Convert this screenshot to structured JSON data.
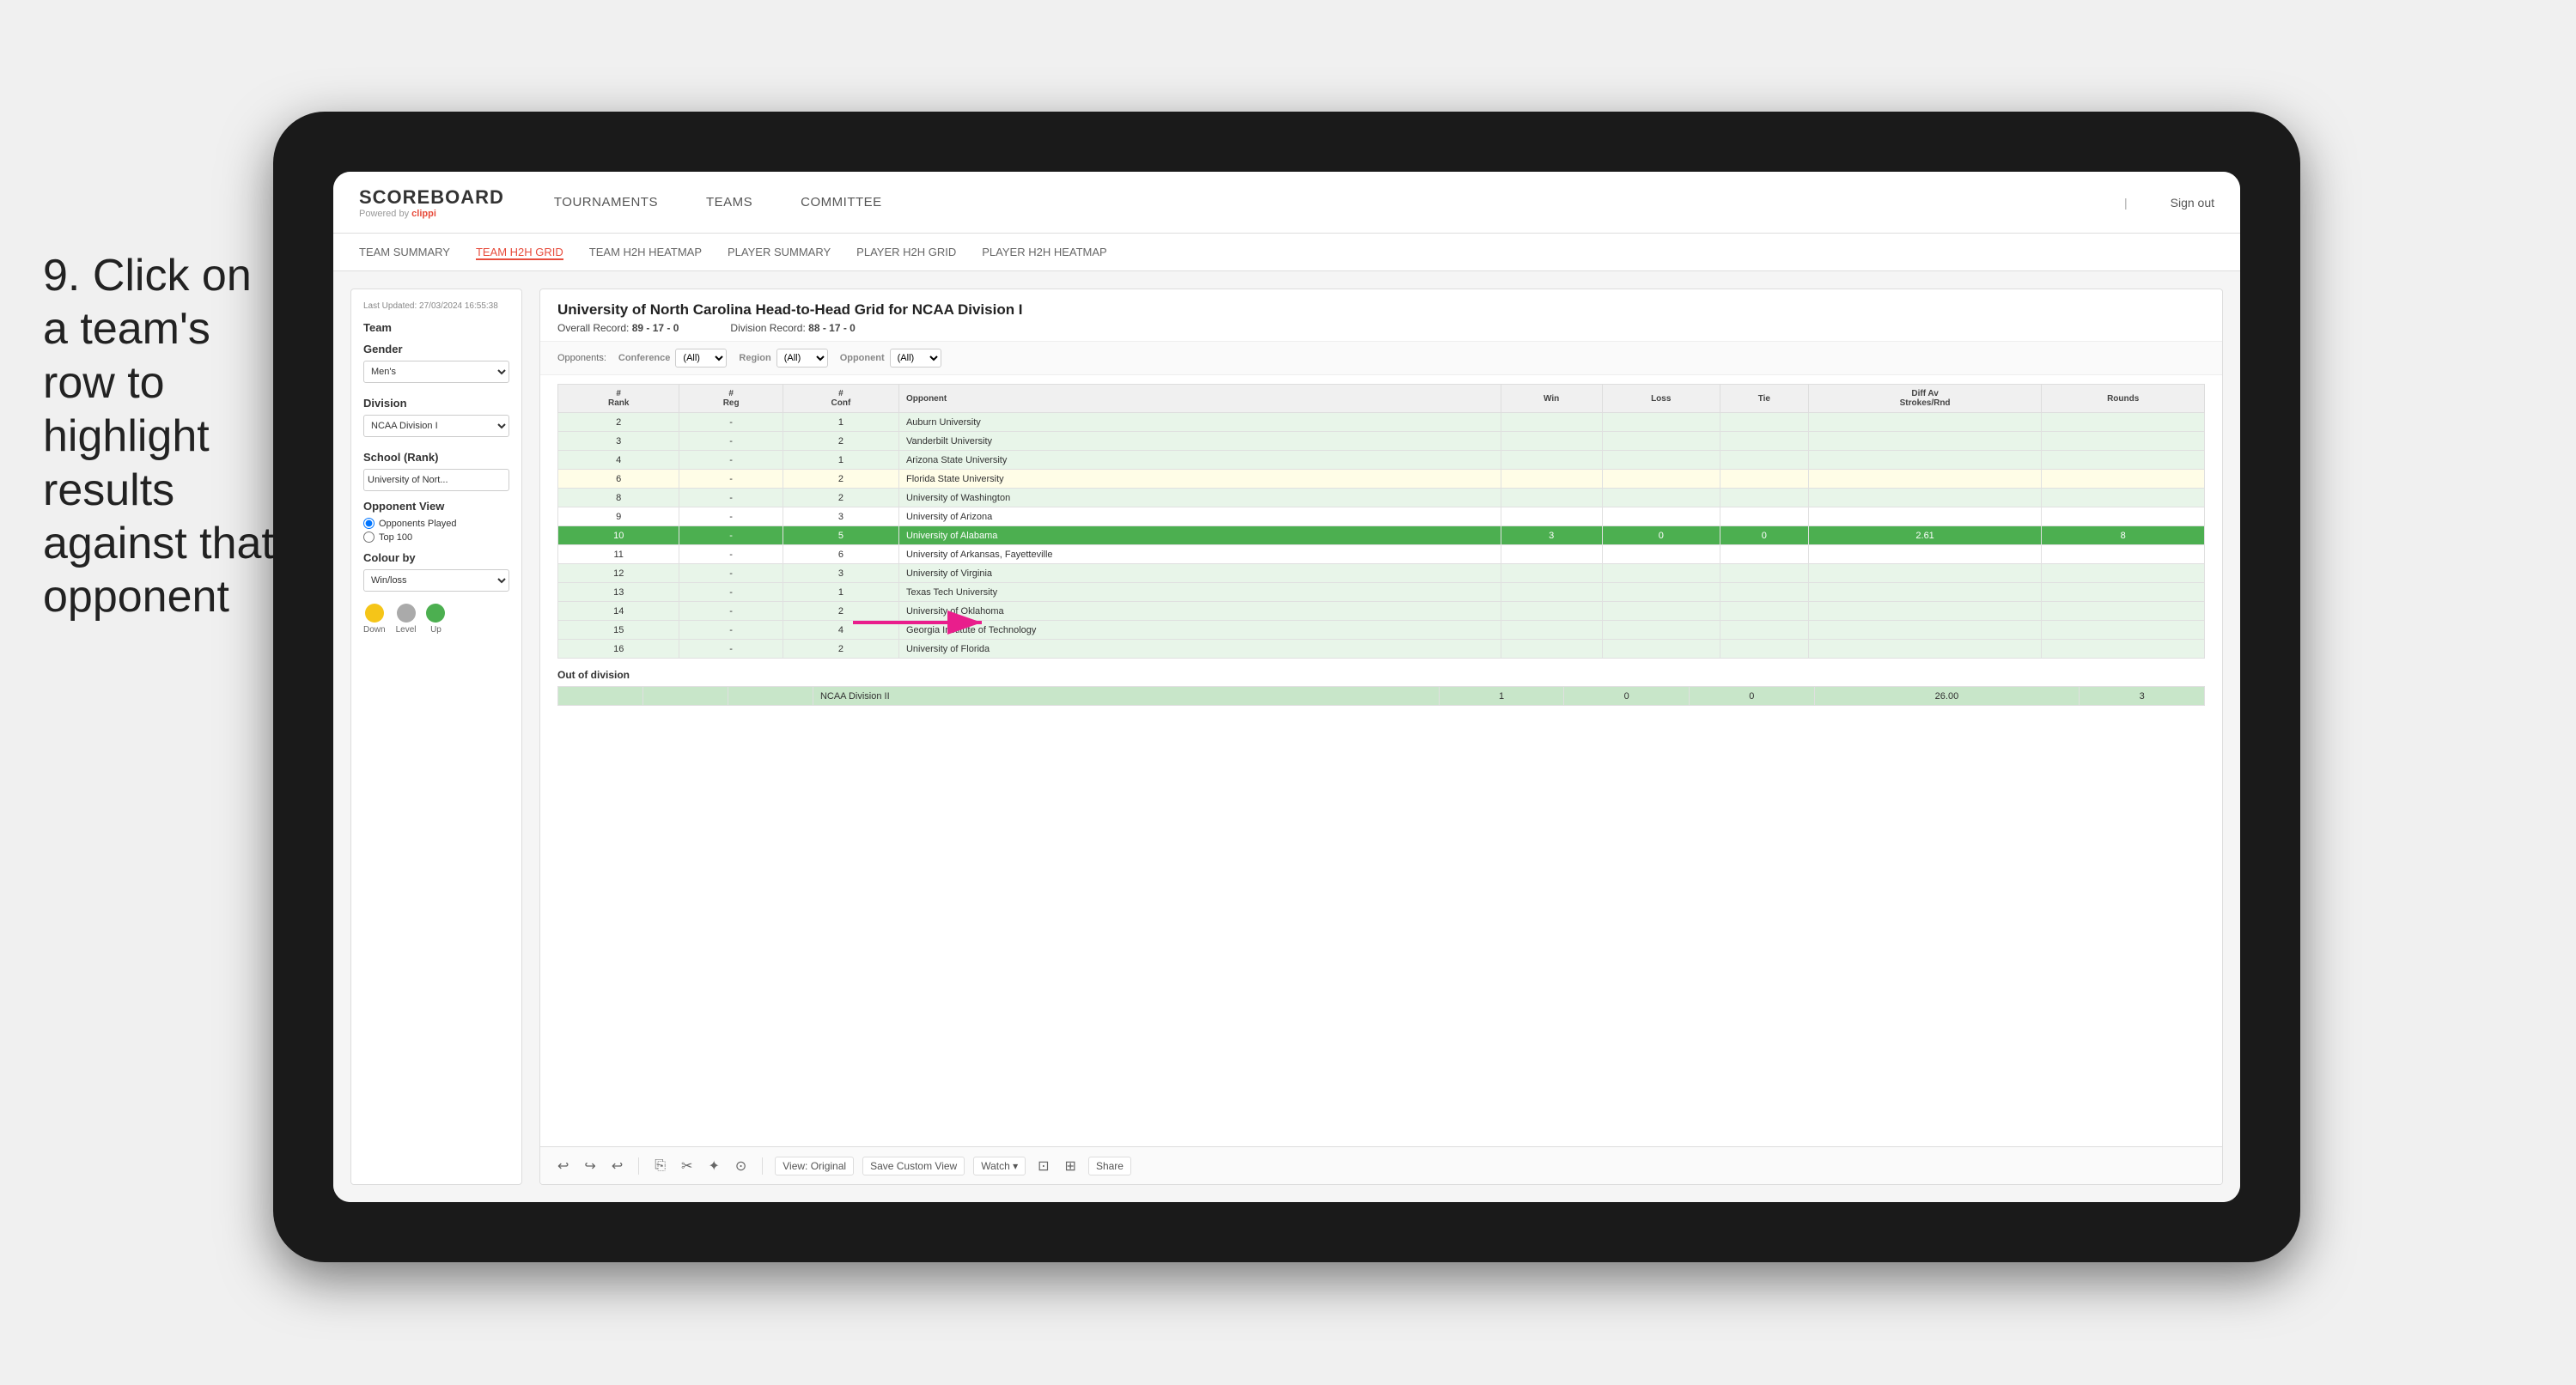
{
  "instruction": {
    "text": "9. Click on a team's row to highlight results against that opponent"
  },
  "header": {
    "logo": "SCOREBOARD",
    "powered_by": "Powered by clippi",
    "nav": {
      "tournaments": "TOURNAMENTS",
      "teams": "TEAMS",
      "committee": "COMMITTEE",
      "sign_out": "Sign out"
    }
  },
  "sub_nav": {
    "items": [
      {
        "label": "TEAM SUMMARY",
        "active": false
      },
      {
        "label": "TEAM H2H GRID",
        "active": true
      },
      {
        "label": "TEAM H2H HEATMAP",
        "active": false
      },
      {
        "label": "PLAYER SUMMARY",
        "active": false
      },
      {
        "label": "PLAYER H2H GRID",
        "active": false
      },
      {
        "label": "PLAYER H2H HEATMAP",
        "active": false
      }
    ]
  },
  "sidebar": {
    "last_updated": "Last Updated: 27/03/2024 16:55:38",
    "team_label": "Team",
    "gender_label": "Gender",
    "gender_value": "Men's",
    "division_label": "Division",
    "division_value": "NCAA Division I",
    "school_label": "School (Rank)",
    "school_value": "University of Nort...",
    "opponent_view_label": "Opponent View",
    "radio_options": [
      {
        "label": "Opponents Played",
        "selected": true
      },
      {
        "label": "Top 100",
        "selected": false
      }
    ],
    "colour_by_label": "Colour by",
    "colour_by_value": "Win/loss",
    "swatches": [
      {
        "color": "#f5c518",
        "label": "Down"
      },
      {
        "color": "#aaa",
        "label": "Level"
      },
      {
        "color": "#4caf50",
        "label": "Up"
      }
    ]
  },
  "main": {
    "title": "University of North Carolina Head-to-Head Grid for NCAA Division I",
    "overall_record_label": "Overall Record:",
    "overall_record": "89 - 17 - 0",
    "division_record_label": "Division Record:",
    "division_record": "88 - 17 - 0",
    "filters": {
      "opponents_label": "Opponents:",
      "conference_label": "Conference",
      "conference_value": "(All)",
      "region_label": "Region",
      "region_value": "(All)",
      "opponent_label": "Opponent",
      "opponent_value": "(All)"
    },
    "table_headers": [
      {
        "label": "#\nRank",
        "key": "rank"
      },
      {
        "label": "#\nReg",
        "key": "reg"
      },
      {
        "label": "#\nConf",
        "key": "conf"
      },
      {
        "label": "Opponent",
        "key": "opponent"
      },
      {
        "label": "Win",
        "key": "win"
      },
      {
        "label": "Loss",
        "key": "loss"
      },
      {
        "label": "Tie",
        "key": "tie"
      },
      {
        "label": "Diff Av\nStrokes/Rnd",
        "key": "diff"
      },
      {
        "label": "Rounds",
        "key": "rounds"
      }
    ],
    "rows": [
      {
        "rank": "2",
        "reg": "-",
        "conf": "1",
        "opponent": "Auburn University",
        "win": "",
        "loss": "",
        "tie": "",
        "diff": "",
        "rounds": "",
        "highlight": "light-green"
      },
      {
        "rank": "3",
        "reg": "-",
        "conf": "2",
        "opponent": "Vanderbilt University",
        "win": "",
        "loss": "",
        "tie": "",
        "diff": "",
        "rounds": "",
        "highlight": "light-green"
      },
      {
        "rank": "4",
        "reg": "-",
        "conf": "1",
        "opponent": "Arizona State University",
        "win": "",
        "loss": "",
        "tie": "",
        "diff": "",
        "rounds": "",
        "highlight": "light-green"
      },
      {
        "rank": "6",
        "reg": "-",
        "conf": "2",
        "opponent": "Florida State University",
        "win": "",
        "loss": "",
        "tie": "",
        "diff": "",
        "rounds": "",
        "highlight": "light-yellow"
      },
      {
        "rank": "8",
        "reg": "-",
        "conf": "2",
        "opponent": "University of Washington",
        "win": "",
        "loss": "",
        "tie": "",
        "diff": "",
        "rounds": "",
        "highlight": "light-green"
      },
      {
        "rank": "9",
        "reg": "-",
        "conf": "3",
        "opponent": "University of Arizona",
        "win": "",
        "loss": "",
        "tie": "",
        "diff": "",
        "rounds": "",
        "highlight": "none"
      },
      {
        "rank": "10",
        "reg": "-",
        "conf": "5",
        "opponent": "University of Alabama",
        "win": "3",
        "loss": "0",
        "tie": "0",
        "diff": "2.61",
        "rounds": "8",
        "highlight": "green-selected"
      },
      {
        "rank": "11",
        "reg": "-",
        "conf": "6",
        "opponent": "University of Arkansas, Fayetteville",
        "win": "",
        "loss": "",
        "tie": "",
        "diff": "",
        "rounds": "",
        "highlight": "none"
      },
      {
        "rank": "12",
        "reg": "-",
        "conf": "3",
        "opponent": "University of Virginia",
        "win": "",
        "loss": "",
        "tie": "",
        "diff": "",
        "rounds": "",
        "highlight": "light-green"
      },
      {
        "rank": "13",
        "reg": "-",
        "conf": "1",
        "opponent": "Texas Tech University",
        "win": "",
        "loss": "",
        "tie": "",
        "diff": "",
        "rounds": "",
        "highlight": "light-green"
      },
      {
        "rank": "14",
        "reg": "-",
        "conf": "2",
        "opponent": "University of Oklahoma",
        "win": "",
        "loss": "",
        "tie": "",
        "diff": "",
        "rounds": "",
        "highlight": "light-green"
      },
      {
        "rank": "15",
        "reg": "-",
        "conf": "4",
        "opponent": "Georgia Institute of Technology",
        "win": "",
        "loss": "",
        "tie": "",
        "diff": "",
        "rounds": "",
        "highlight": "light-green"
      },
      {
        "rank": "16",
        "reg": "-",
        "conf": "2",
        "opponent": "University of Florida",
        "win": "",
        "loss": "",
        "tie": "",
        "diff": "",
        "rounds": "",
        "highlight": "light-green"
      }
    ],
    "out_of_division_label": "Out of division",
    "out_of_division_row": {
      "label": "NCAA Division II",
      "win": "1",
      "loss": "0",
      "tie": "0",
      "diff": "26.00",
      "rounds": "3"
    }
  },
  "toolbar": {
    "buttons": [
      "↩",
      "↪",
      "↩",
      "⎘",
      "✂",
      "✦",
      "⊙"
    ],
    "view_original": "View: Original",
    "save_custom_view": "Save Custom View",
    "watch": "Watch ▾",
    "share": "Share"
  }
}
